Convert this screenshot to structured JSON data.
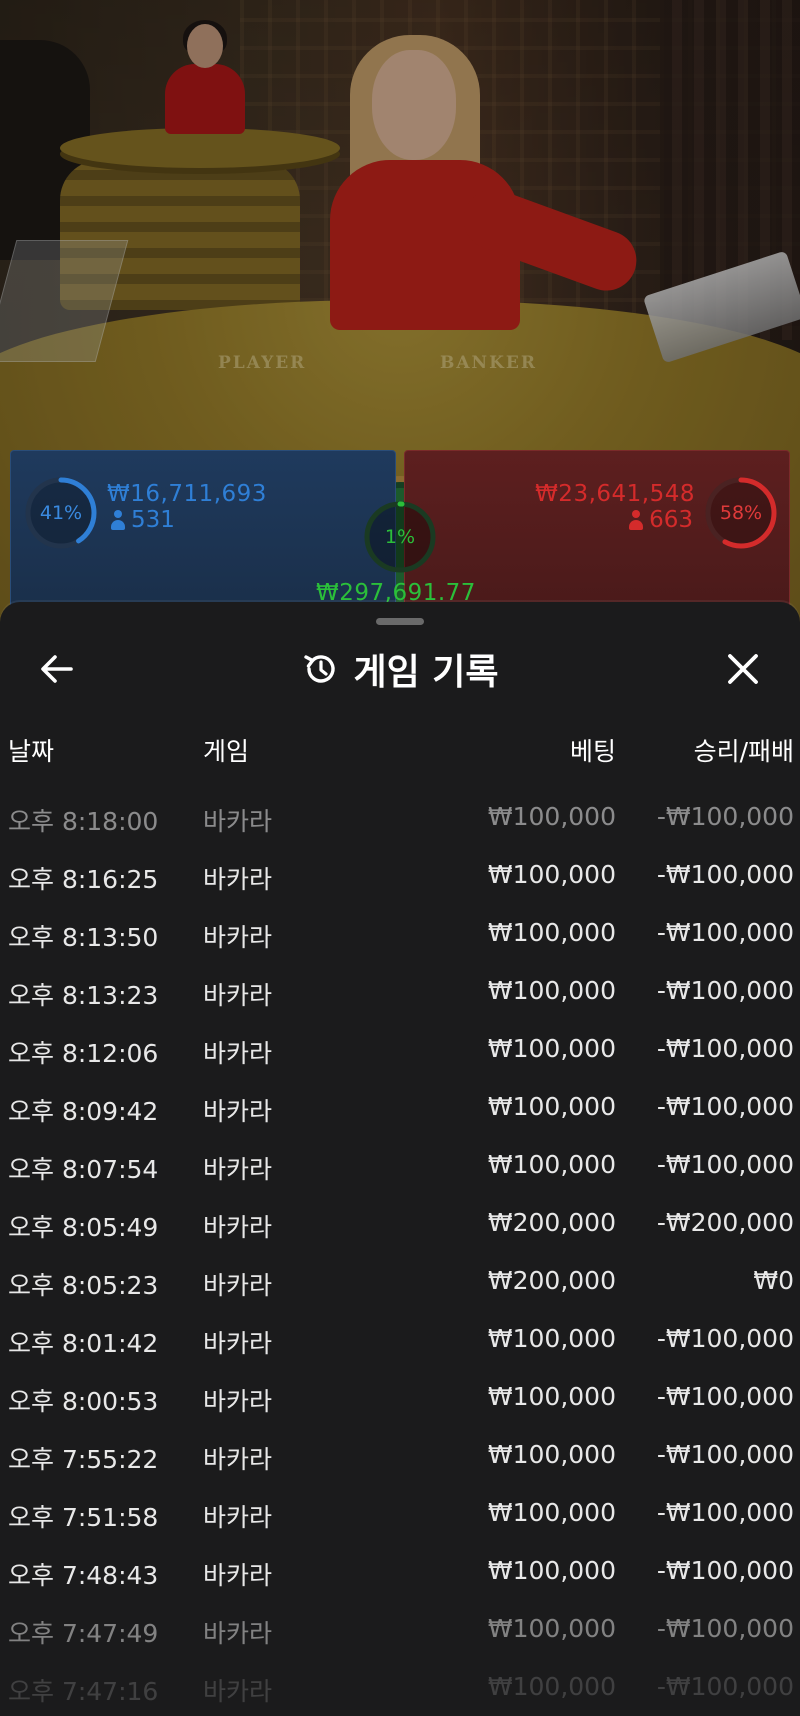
{
  "betting_stats": {
    "player": {
      "percent_label": "41%",
      "percent": 41,
      "amount": "₩16,711,693",
      "players": "531",
      "color": "#2f7fd6"
    },
    "banker": {
      "percent_label": "58%",
      "percent": 58,
      "amount": "₩23,641,548",
      "players": "663",
      "color": "#d42b2b"
    },
    "tie": {
      "percent_label": "1%",
      "percent": 1,
      "amount": "₩297,691.77",
      "color": "#2bbf3a"
    }
  },
  "table_felt": {
    "player_label": "PLAYER",
    "banker_label": "BANKER"
  },
  "history_sheet": {
    "title": "게임 기록",
    "title_icon": "history-icon",
    "back_icon": "arrow-left-icon",
    "close_icon": "close-icon",
    "columns": {
      "date": "날짜",
      "game": "게임",
      "bet": "베팅",
      "win_loss": "승리/패배"
    },
    "rows": [
      {
        "time": "오후 8:18:00",
        "game": "바카라",
        "bet": "₩100,000",
        "result": "-₩100,000"
      },
      {
        "time": "오후 8:16:25",
        "game": "바카라",
        "bet": "₩100,000",
        "result": "-₩100,000"
      },
      {
        "time": "오후 8:13:50",
        "game": "바카라",
        "bet": "₩100,000",
        "result": "-₩100,000"
      },
      {
        "time": "오후 8:13:23",
        "game": "바카라",
        "bet": "₩100,000",
        "result": "-₩100,000"
      },
      {
        "time": "오후 8:12:06",
        "game": "바카라",
        "bet": "₩100,000",
        "result": "-₩100,000"
      },
      {
        "time": "오후 8:09:42",
        "game": "바카라",
        "bet": "₩100,000",
        "result": "-₩100,000"
      },
      {
        "time": "오후 8:07:54",
        "game": "바카라",
        "bet": "₩100,000",
        "result": "-₩100,000"
      },
      {
        "time": "오후 8:05:49",
        "game": "바카라",
        "bet": "₩200,000",
        "result": "-₩200,000"
      },
      {
        "time": "오후 8:05:23",
        "game": "바카라",
        "bet": "₩200,000",
        "result": "₩0"
      },
      {
        "time": "오후 8:01:42",
        "game": "바카라",
        "bet": "₩100,000",
        "result": "-₩100,000"
      },
      {
        "time": "오후 8:00:53",
        "game": "바카라",
        "bet": "₩100,000",
        "result": "-₩100,000"
      },
      {
        "time": "오후 7:55:22",
        "game": "바카라",
        "bet": "₩100,000",
        "result": "-₩100,000"
      },
      {
        "time": "오후 7:51:58",
        "game": "바카라",
        "bet": "₩100,000",
        "result": "-₩100,000"
      },
      {
        "time": "오후 7:48:43",
        "game": "바카라",
        "bet": "₩100,000",
        "result": "-₩100,000"
      },
      {
        "time": "오후 7:47:49",
        "game": "바카라",
        "bet": "₩100,000",
        "result": "-₩100,000"
      },
      {
        "time": "오후 7:47:16",
        "game": "바카라",
        "bet": "₩100,000",
        "result": "-₩100,000"
      }
    ]
  }
}
